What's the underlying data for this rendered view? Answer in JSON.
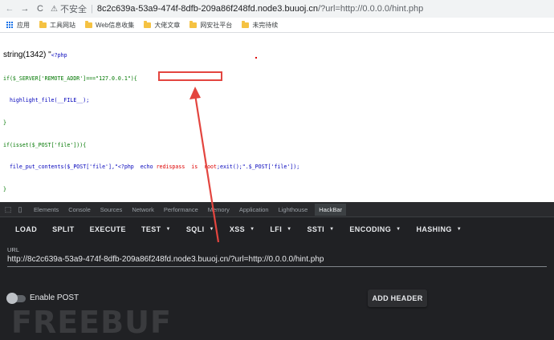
{
  "browser": {
    "nav": {
      "back": "←",
      "forward": "→",
      "reload": "C"
    },
    "security_label": "不安全",
    "url_host": "8c2c639a-53a9-474f-8dfb-209a86f248fd.node3.buuoj.cn",
    "url_rest": "/?url=http://0.0.0.0/hint.php",
    "bookmarks": [
      "应用",
      "工具网站",
      "Web信息收集",
      "大佬文章",
      "网安社平台",
      "未完待续"
    ]
  },
  "page": {
    "string_prefix": "string(1342) \"",
    "code_lines": [
      "<?php",
      "if($_SERVER['REMOTE_ADDR']===\"127.0.0.1\"){",
      "  highlight_file(__FILE__);",
      "}",
      "if(isset($_POST['file'])){",
      "  file_put_contents($_POST['file'],\"<?php  echo ",
      "}"
    ],
    "highlighted": "redispass  is  root",
    "code_tail": ";exit();\".$_POST['file']);",
    "closing_quote": "\""
  },
  "devtools": {
    "tabs": [
      "Elements",
      "Console",
      "Sources",
      "Network",
      "Performance",
      "Memory",
      "Application",
      "Lighthouse",
      "HackBar"
    ],
    "active_tab": "HackBar"
  },
  "hackbar": {
    "toolbar": [
      {
        "label": "LOAD",
        "dropdown": false
      },
      {
        "label": "SPLIT",
        "dropdown": false
      },
      {
        "label": "EXECUTE",
        "dropdown": false
      },
      {
        "label": "TEST",
        "dropdown": true
      },
      {
        "label": "SQLI",
        "dropdown": true
      },
      {
        "label": "XSS",
        "dropdown": true
      },
      {
        "label": "LFI",
        "dropdown": true
      },
      {
        "label": "SSTI",
        "dropdown": true
      },
      {
        "label": "ENCODING",
        "dropdown": true
      },
      {
        "label": "HASHING",
        "dropdown": true
      }
    ],
    "url_label": "URL",
    "url_value": "http://8c2c639a-53a9-474f-8dfb-209a86f248fd.node3.buuoj.cn/?url=http://0.0.0.0/hint.php",
    "enable_post_label": "Enable POST",
    "enable_post": false,
    "add_header_label": "ADD HEADER"
  },
  "watermark": "FREEBUF",
  "colors": {
    "annotation": "#e3453f"
  }
}
